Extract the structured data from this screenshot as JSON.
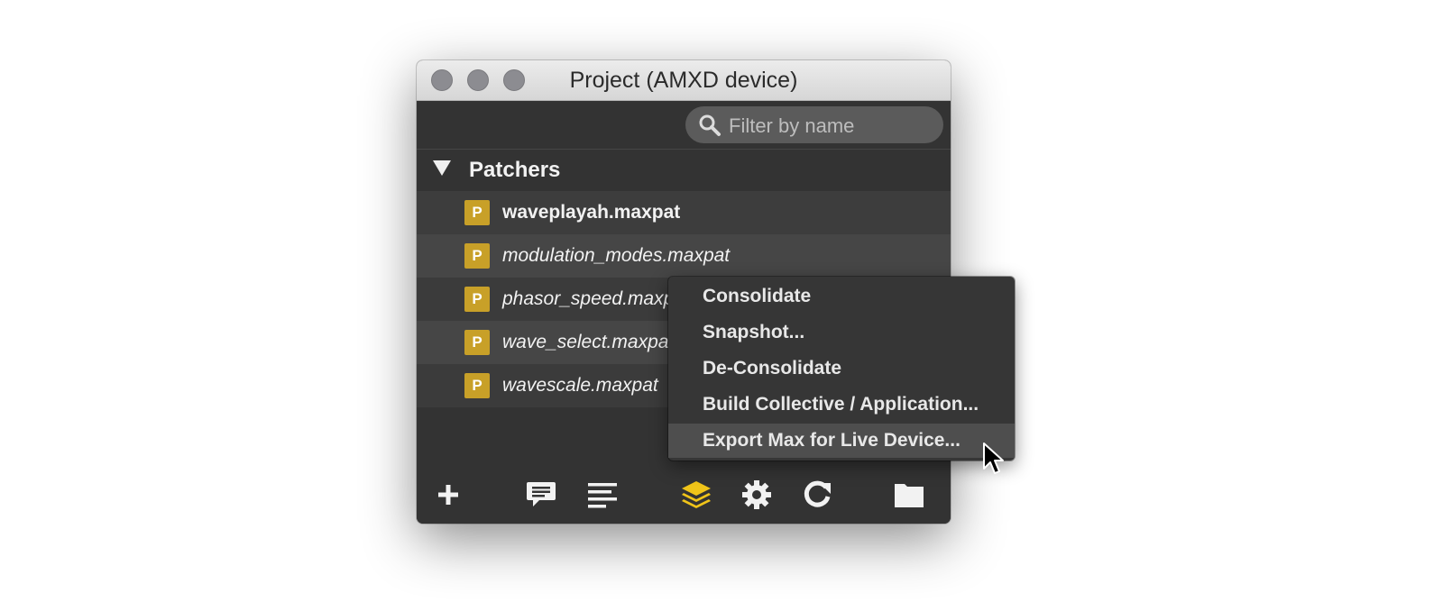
{
  "window": {
    "title": "Project (AMXD device)"
  },
  "search": {
    "placeholder": "Filter by name"
  },
  "group": {
    "label": "Patchers"
  },
  "files": [
    {
      "name": "waveplayah.maxpat",
      "icon_letter": "P"
    },
    {
      "name": "modulation_modes.maxpat",
      "icon_letter": "P"
    },
    {
      "name": "phasor_speed.maxpat",
      "icon_letter": "P"
    },
    {
      "name": "wave_select.maxpat",
      "icon_letter": "P"
    },
    {
      "name": "wavescale.maxpat",
      "icon_letter": "P"
    }
  ],
  "menu": {
    "items": [
      {
        "label": "Consolidate"
      },
      {
        "label": "Snapshot..."
      },
      {
        "label": "De-Consolidate"
      },
      {
        "label": "Build Collective / Application..."
      },
      {
        "label": "Export Max for Live Device..."
      }
    ],
    "highlighted_index": 4
  },
  "bottom_toolbar": {
    "icons": [
      "plus-icon",
      "comment-icon",
      "list-icon",
      "layers-icon",
      "gear-icon",
      "refresh-icon",
      "folder-icon"
    ],
    "active_icon": "layers-icon",
    "accent_color": "#f0c419"
  },
  "colors": {
    "panel_bg": "#333333",
    "icon_badge": "#c8a028"
  }
}
